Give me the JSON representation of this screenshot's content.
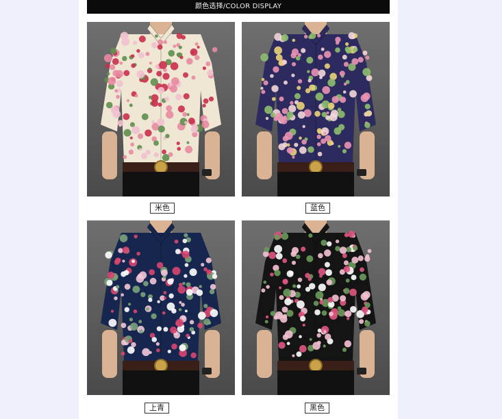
{
  "header": {
    "title": "颜色选择/COLOR DISPLAY"
  },
  "products": [
    {
      "label": "米色",
      "shirt_color": "#efe6d4",
      "flower_colors": [
        "#c9304a",
        "#e88aa1",
        "#5f8f4e",
        "#f1c1cf"
      ]
    },
    {
      "label": "蓝色",
      "shirt_color": "#2c2a5e",
      "flower_colors": [
        "#e993b4",
        "#f3d6d8",
        "#e9d27a",
        "#8dbd6d"
      ]
    },
    {
      "label": "上青",
      "shirt_color": "#16264f",
      "flower_colors": [
        "#f2c6d8",
        "#d8466f",
        "#ffffff",
        "#7aa37a"
      ]
    },
    {
      "label": "黑色",
      "shirt_color": "#141414",
      "flower_colors": [
        "#f3c2d2",
        "#e0577f",
        "#ffffff",
        "#6a9a5b"
      ]
    }
  ]
}
